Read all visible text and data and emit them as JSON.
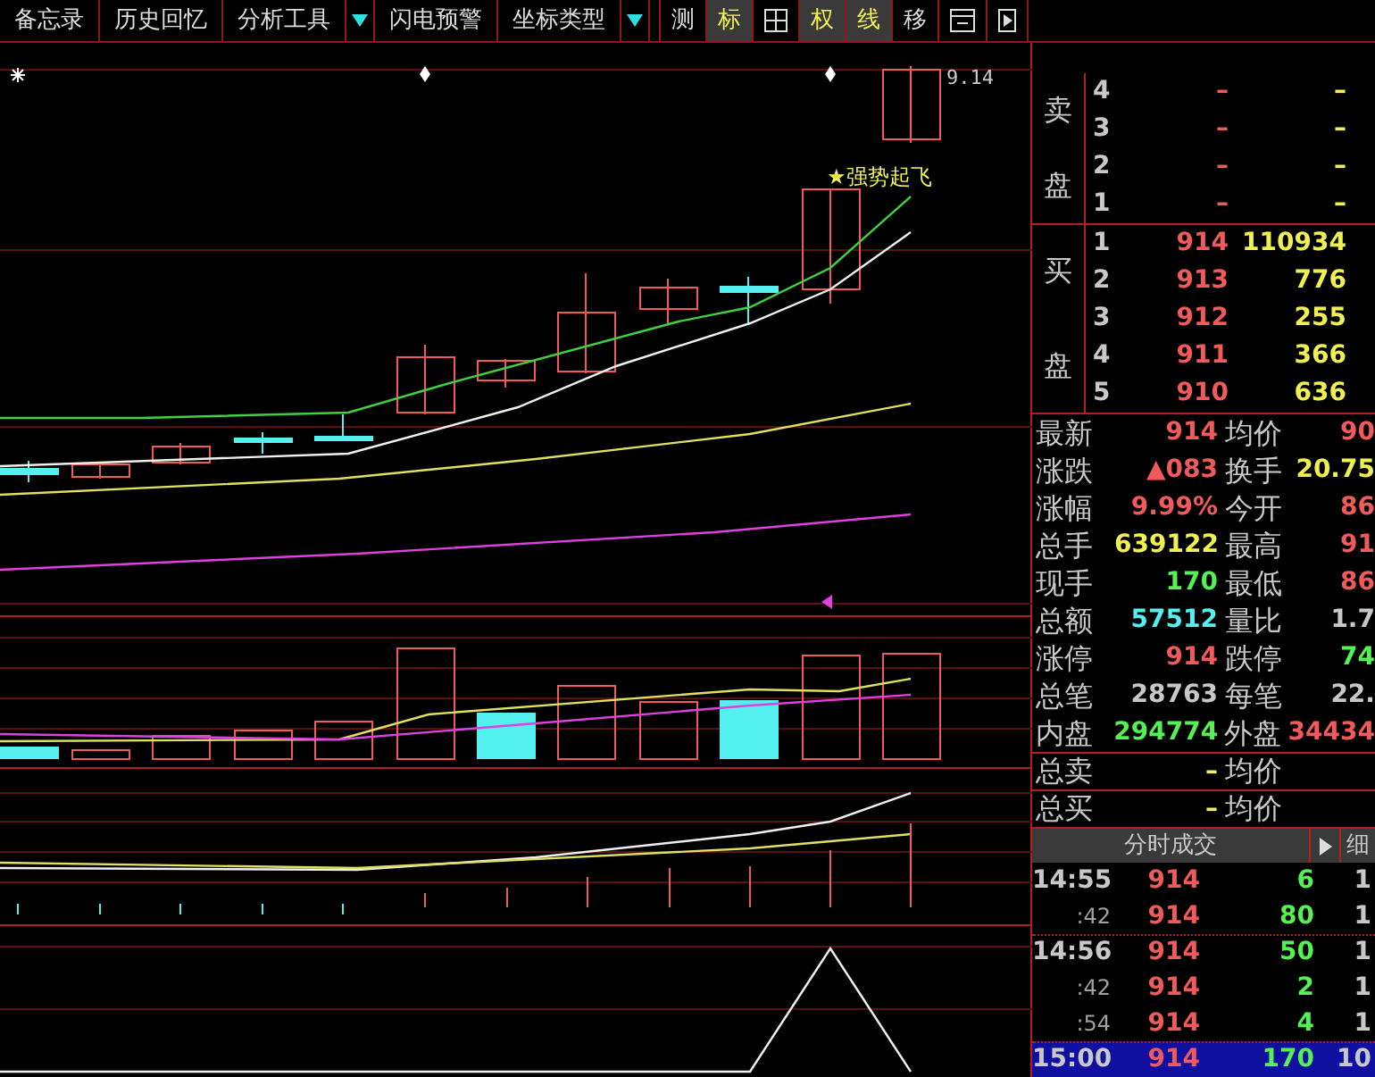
{
  "toolbar": {
    "left": [
      {
        "label": "备忘录",
        "kind": "text"
      },
      {
        "label": "历史回忆",
        "kind": "text"
      },
      {
        "label": "分析工具",
        "kind": "dropdown"
      },
      {
        "label": "闪电预警",
        "kind": "text"
      },
      {
        "label": "坐标类型",
        "kind": "dropdown"
      }
    ],
    "right": [
      {
        "label": "测",
        "kind": "text",
        "selected": false
      },
      {
        "label": "标",
        "kind": "text",
        "selected": true
      },
      {
        "kind": "plus-icon",
        "selected": false
      },
      {
        "label": "权",
        "kind": "text",
        "selected": true
      },
      {
        "label": "线",
        "kind": "text",
        "selected": true
      },
      {
        "label": "移",
        "kind": "text",
        "selected": false
      },
      {
        "kind": "window-icon",
        "selected": false
      },
      {
        "kind": "play-icon",
        "selected": false
      }
    ]
  },
  "chart": {
    "price_label": "9.14",
    "signal": "★强势起飞"
  },
  "order_book": {
    "sell": {
      "label": [
        "卖",
        "盘"
      ],
      "rows": [
        {
          "rank": "4",
          "price": "–",
          "volume": "–"
        },
        {
          "rank": "3",
          "price": "–",
          "volume": "–"
        },
        {
          "rank": "2",
          "price": "–",
          "volume": "–"
        },
        {
          "rank": "1",
          "price": "–",
          "volume": "–"
        }
      ]
    },
    "buy": {
      "label": [
        "买",
        "盘"
      ],
      "rows": [
        {
          "rank": "1",
          "price": "914",
          "volume": "110934"
        },
        {
          "rank": "2",
          "price": "913",
          "volume": "776"
        },
        {
          "rank": "3",
          "price": "912",
          "volume": "255"
        },
        {
          "rank": "4",
          "price": "911",
          "volume": "366"
        },
        {
          "rank": "5",
          "price": "910",
          "volume": "636"
        }
      ]
    }
  },
  "stats": [
    [
      {
        "label": "最新",
        "value": "914",
        "color": "#f05a5a"
      },
      {
        "label": "均价",
        "value": "90",
        "color": "#f05a5a"
      }
    ],
    [
      {
        "label": "涨跌",
        "value": "▲083",
        "color": "#f05a5a"
      },
      {
        "label": "换手",
        "value": "20.75",
        "color": "#f0f050"
      }
    ],
    [
      {
        "label": "涨幅",
        "value": "9.99%",
        "color": "#f05a5a"
      },
      {
        "label": "今开",
        "value": "86",
        "color": "#f05a5a"
      }
    ],
    [
      {
        "label": "总手",
        "value": "639122",
        "color": "#f0f050"
      },
      {
        "label": "最高",
        "value": "91",
        "color": "#f05a5a"
      }
    ],
    [
      {
        "label": "现手",
        "value": "170",
        "color": "#54f054"
      },
      {
        "label": "最低",
        "value": "86",
        "color": "#f05a5a"
      }
    ],
    [
      {
        "label": "总额",
        "value": "57512",
        "color": "#54f0f0"
      },
      {
        "label": "量比",
        "value": "1.7",
        "color": "#c8c8c8"
      }
    ],
    [
      {
        "label": "涨停",
        "value": "914",
        "color": "#f05a5a"
      },
      {
        "label": "跌停",
        "value": "74",
        "color": "#54f054"
      }
    ],
    [
      {
        "label": "总笔",
        "value": "28763",
        "color": "#c8c8c8"
      },
      {
        "label": "每笔",
        "value": "22.",
        "color": "#c8c8c8"
      }
    ],
    [
      {
        "label": "内盘",
        "value": "294774",
        "color": "#54f054"
      },
      {
        "label": "外盘",
        "value": "34434",
        "color": "#f05a5a"
      }
    ]
  ],
  "totals": [
    {
      "label": "总卖",
      "value": "–",
      "label2": "均价"
    },
    {
      "label": "总买",
      "value": "–",
      "label2": "均价"
    }
  ],
  "trades": {
    "title": "分时成交",
    "tab": "细",
    "rows": [
      {
        "time": "14:55",
        "price": "914",
        "volume": "6",
        "count": "1",
        "selected": false,
        "group_start": true
      },
      {
        "time": ":42",
        "price": "914",
        "volume": "80",
        "count": "1",
        "selected": false,
        "group_start": false
      },
      {
        "time": "14:56",
        "price": "914",
        "volume": "50",
        "count": "1",
        "selected": false,
        "group_start": true
      },
      {
        "time": ":42",
        "price": "914",
        "volume": "2",
        "count": "1",
        "selected": false,
        "group_start": false
      },
      {
        "time": ":54",
        "price": "914",
        "volume": "4",
        "count": "1",
        "selected": false,
        "group_start": false
      },
      {
        "time": "15:00",
        "price": "914",
        "volume": "170",
        "count": "10",
        "selected": true,
        "group_start": true
      }
    ]
  }
}
